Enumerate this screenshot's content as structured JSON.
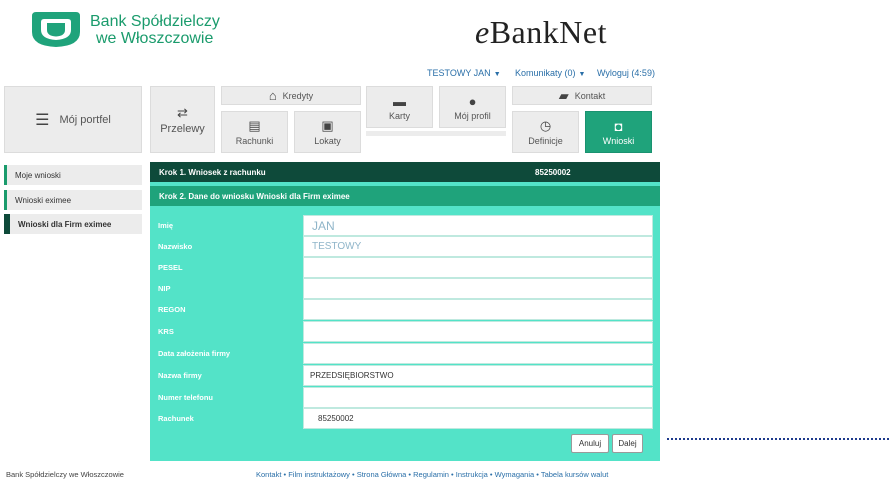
{
  "brand": {
    "bank_line1": "Bank Spółdzielczy",
    "bank_line2": "we Włoszczowie",
    "app_prefix": "e",
    "app_rest": "BankNet",
    "brand_color": "#1fa37b",
    "dark_color": "#0e4a3a",
    "panel_color": "#53e3c8"
  },
  "userbar": {
    "user": "TESTOWY JAN",
    "messages": "Komunikaty (0)",
    "logout": "Wyloguj (4:59)"
  },
  "nav": {
    "portfel": "Mój portfel",
    "przelewy": "Przelewy",
    "kredyty": "Kredyty",
    "rachunki": "Rachunki",
    "lokaty": "Lokaty",
    "karty": "Karty",
    "profil": "Mój profil",
    "kontakt": "Kontakt",
    "definicje": "Definicje",
    "wnioski": "Wnioski"
  },
  "sidebar": {
    "items": [
      {
        "label": "Moje wnioski"
      },
      {
        "label": "Wnioski eximee"
      },
      {
        "label": "Wnioski dla Firm eximee",
        "active": true
      }
    ]
  },
  "form": {
    "step1": "Krok 1. Wniosek z rachunku",
    "step1_number": "85250002",
    "step2": "Krok 2. Dane do wniosku Wnioski dla Firm eximee",
    "fields": [
      {
        "label": "Imię",
        "value": "JAN"
      },
      {
        "label": "Nazwisko",
        "value": "TESTOWY"
      },
      {
        "label": "PESEL",
        "value": ""
      },
      {
        "label": "NIP",
        "value": ""
      },
      {
        "label": "REGON",
        "value": ""
      },
      {
        "label": "KRS",
        "value": ""
      },
      {
        "label": "Data założenia firmy",
        "value": ""
      },
      {
        "label": "Nazwa firmy",
        "value": "PRZEDSIĘBIORSTWO"
      },
      {
        "label": "Numer telefonu",
        "value": ""
      },
      {
        "label": "Rachunek",
        "value": "85250002"
      }
    ],
    "cancel": "Anuluj",
    "next": "Dalej"
  },
  "footer": {
    "bank": "Bank Spółdzielczy we Włoszczowie",
    "links": "Kontakt • Film instruktażowy • Strona Główna • Regulamin • Instrukcja • Wymagania • Tabela kursów walut"
  }
}
